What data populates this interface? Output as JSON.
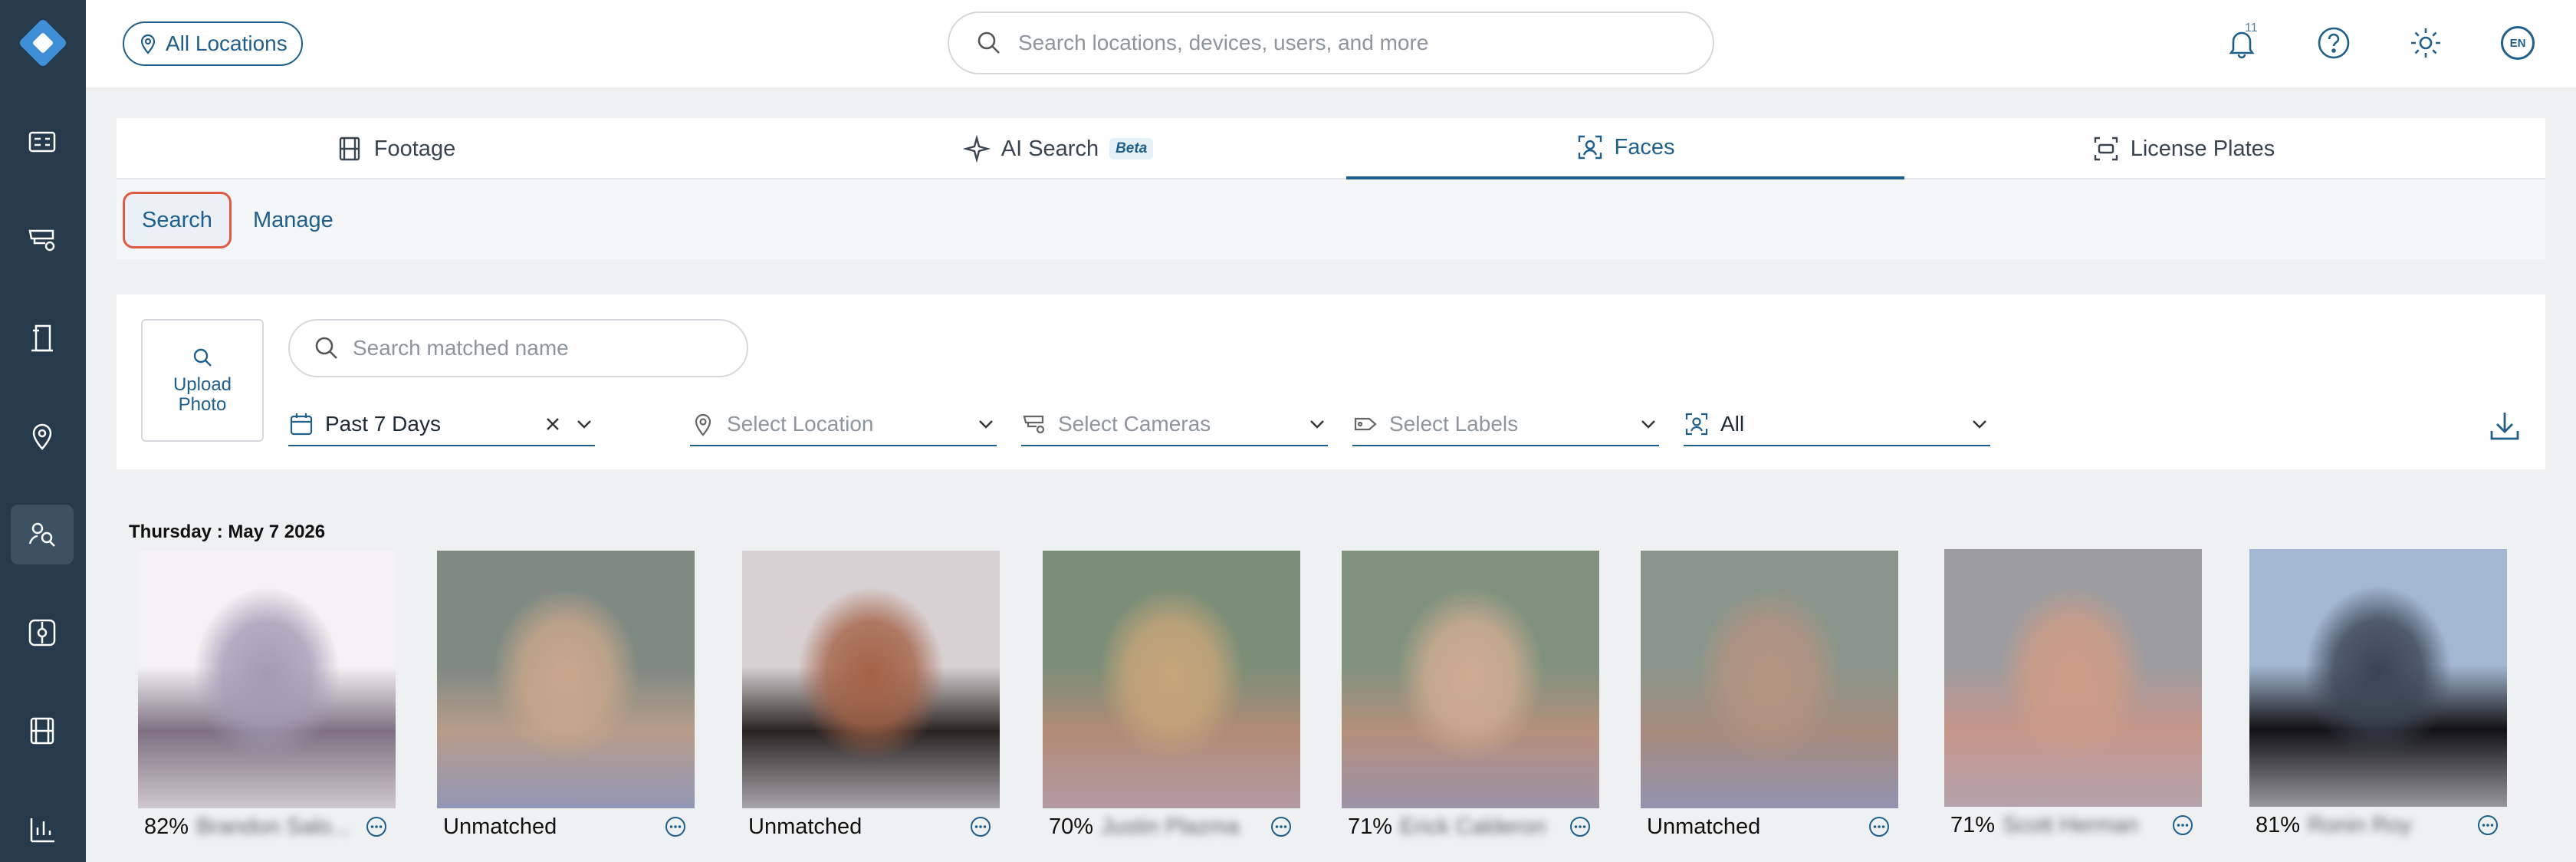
{
  "topbar": {
    "location_label": "All Locations",
    "search_placeholder": "Search locations, devices, users, and more",
    "notification_count": "11",
    "language": "EN"
  },
  "sidebar": {
    "items": [
      {
        "icon": "dashboard-icon"
      },
      {
        "icon": "camera-icon"
      },
      {
        "icon": "door-access-icon"
      },
      {
        "icon": "location-pin-icon"
      },
      {
        "icon": "people-search-icon",
        "active": true
      },
      {
        "icon": "sensor-icon"
      },
      {
        "icon": "film-icon"
      },
      {
        "icon": "analytics-icon"
      }
    ]
  },
  "tabs": [
    {
      "label": "Footage",
      "icon": "film-icon"
    },
    {
      "label": "AI Search",
      "icon": "sparkle-icon",
      "badge": "Beta"
    },
    {
      "label": "Faces",
      "icon": "face-scan-icon",
      "active": true
    },
    {
      "label": "License Plates",
      "icon": "plate-scan-icon"
    }
  ],
  "subtabs": [
    {
      "label": "Search",
      "active": true
    },
    {
      "label": "Manage"
    }
  ],
  "filters": {
    "upload_label": "Upload Photo",
    "name_placeholder": "Search matched name",
    "date_range": "Past 7 Days",
    "location_placeholder": "Select Location",
    "cameras_placeholder": "Select Cameras",
    "labels_placeholder": "Select Labels",
    "match_filter": "All"
  },
  "results": {
    "date_header": "Thursday : May 7 2026",
    "faces": [
      {
        "percent": "82%",
        "name": "Brandon Salo...",
        "matched": true,
        "colors": [
          "#f4f2f4",
          "#a49ab4",
          "#7e7082",
          "#cfc8cc"
        ]
      },
      {
        "percent": "",
        "name": "Unmatched",
        "matched": false,
        "colors": [
          "#7f8a82",
          "#c9a78c",
          "#b79d8a",
          "#9197b6"
        ]
      },
      {
        "percent": "",
        "name": "Unmatched",
        "matched": false,
        "colors": [
          "#d8d0d2",
          "#a36246",
          "#2a2424",
          "#a8a6aa"
        ]
      },
      {
        "percent": "70%",
        "name": "Justin Plazma",
        "matched": true,
        "colors": [
          "#7b8e78",
          "#c7a579",
          "#b18b76",
          "#b39aa2"
        ]
      },
      {
        "percent": "71%",
        "name": "Erick Calderon",
        "matched": true,
        "colors": [
          "#80927e",
          "#cfac92",
          "#b5907c",
          "#9c93a8"
        ]
      },
      {
        "percent": "",
        "name": "Unmatched",
        "matched": false,
        "colors": [
          "#89958a",
          "#b49482",
          "#a58a7c",
          "#9393b0"
        ]
      },
      {
        "percent": "71%",
        "name": "Scott Herman",
        "matched": true,
        "colors": [
          "#9c9ca0",
          "#cf9c86",
          "#c7968a",
          "#b3a2ab"
        ]
      },
      {
        "percent": "81%",
        "name": "Ronin Roy",
        "matched": true,
        "colors": [
          "#a2b8d2",
          "#3a4452",
          "#121214",
          "#98989c"
        ]
      }
    ]
  }
}
